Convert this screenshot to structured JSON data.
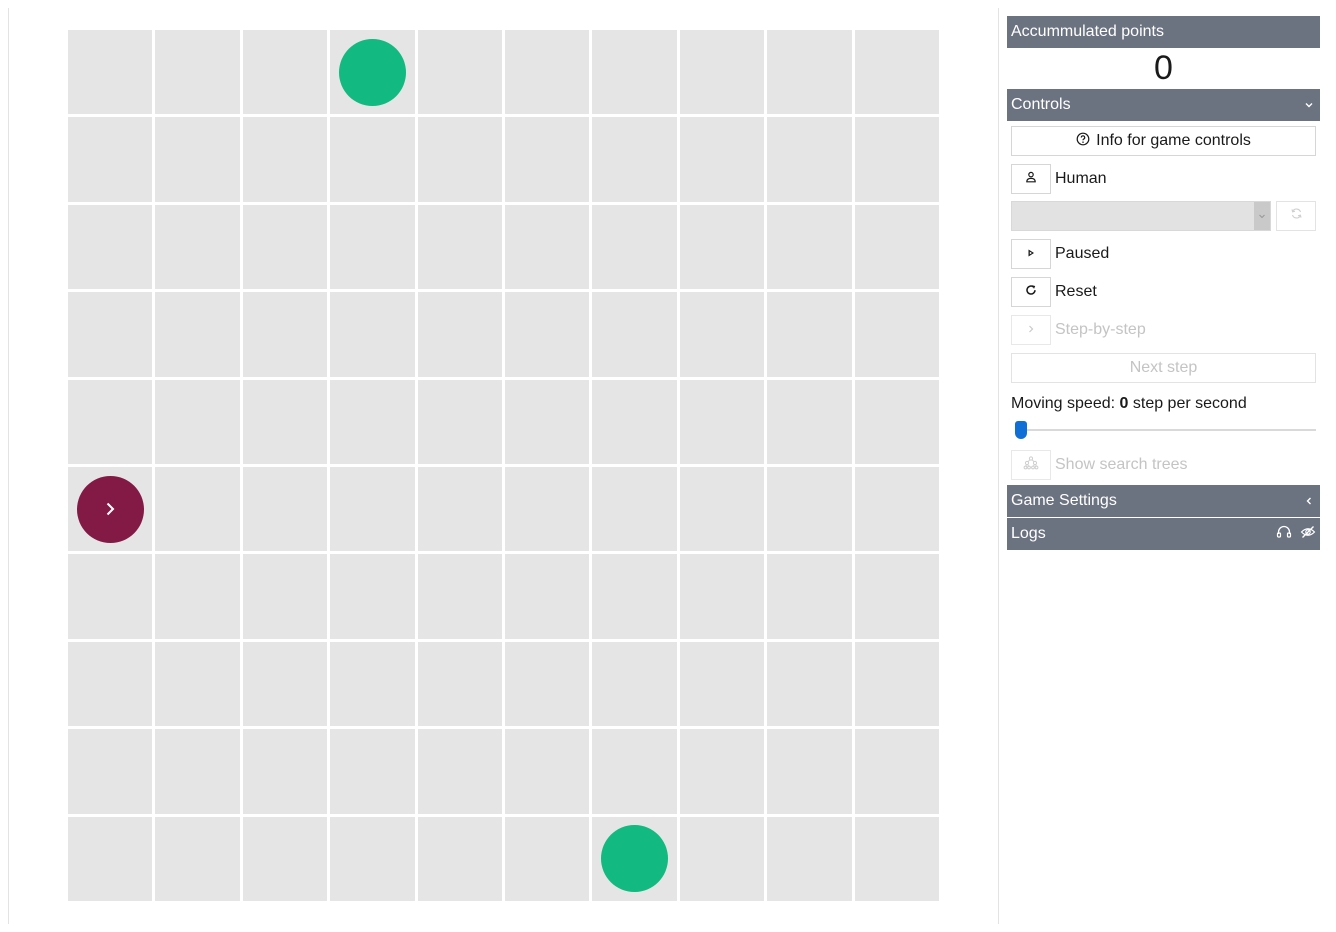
{
  "board": {
    "rows": 10,
    "cols": 10,
    "goals": [
      {
        "row": 0,
        "col": 3
      },
      {
        "row": 9,
        "col": 6
      }
    ],
    "agent": {
      "row": 5,
      "col": 0,
      "facing": "right"
    },
    "colors": {
      "cell": "#e5e5e5",
      "goal": "#12b981",
      "agent": "#821a45"
    }
  },
  "sidebar": {
    "points_header": "Accummulated points",
    "points_value": "0",
    "controls_header": "Controls",
    "info_button": "Info for game controls",
    "player_mode": "Human",
    "play_state": "Paused",
    "reset_label": "Reset",
    "step_by_step_label": "Step-by-step",
    "next_step_label": "Next step",
    "speed_prefix": "Moving speed: ",
    "speed_value": "0",
    "speed_suffix": " step per second",
    "show_trees_label": "Show search trees",
    "settings_header": "Game Settings",
    "logs_header": "Logs",
    "header_color": "#6b7280",
    "accent": "#0f6fd6"
  }
}
